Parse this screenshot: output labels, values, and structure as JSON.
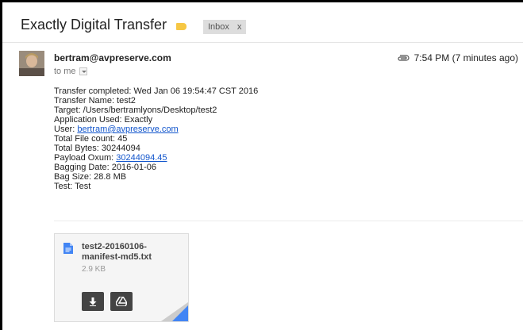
{
  "subject": "Exactly Digital Transfer",
  "label": {
    "text": "Inbox",
    "close": "x",
    "tag_color": "#f6c744"
  },
  "sender": {
    "email": "bertram@avpreserve.com",
    "recipient": "to me"
  },
  "meta": {
    "time": "7:54 PM (7 minutes ago)",
    "icon": "paperclip-icon"
  },
  "body": {
    "transfer_completed": "Transfer completed: Wed Jan 06 19:54:47 CST 2016",
    "transfer_name": "Transfer Name: test2",
    "target": "Target: /Users/bertramlyons/Desktop/test2",
    "application": "Application Used: Exactly",
    "user_prefix": "User: ",
    "user_link": "bertram@avpreserve.com",
    "file_count": "Total File count: 45",
    "total_bytes": "Total Bytes: 30244094",
    "oxum_prefix": "Payload Oxum: ",
    "oxum_link": "30244094.45",
    "bagging_date": "Bagging Date: 2016-01-06",
    "bag_size": "Bag Size: 28.8 MB",
    "test": "Test: Test"
  },
  "attachment": {
    "name_line1": "test2-20160106-",
    "name_line2": "manifest-md5.txt",
    "size": "2.9 KB",
    "icons": [
      "doc-icon",
      "download-icon",
      "drive-icon"
    ]
  },
  "colors": {
    "link": "#1155cc",
    "accent_blue": "#4285f4"
  }
}
